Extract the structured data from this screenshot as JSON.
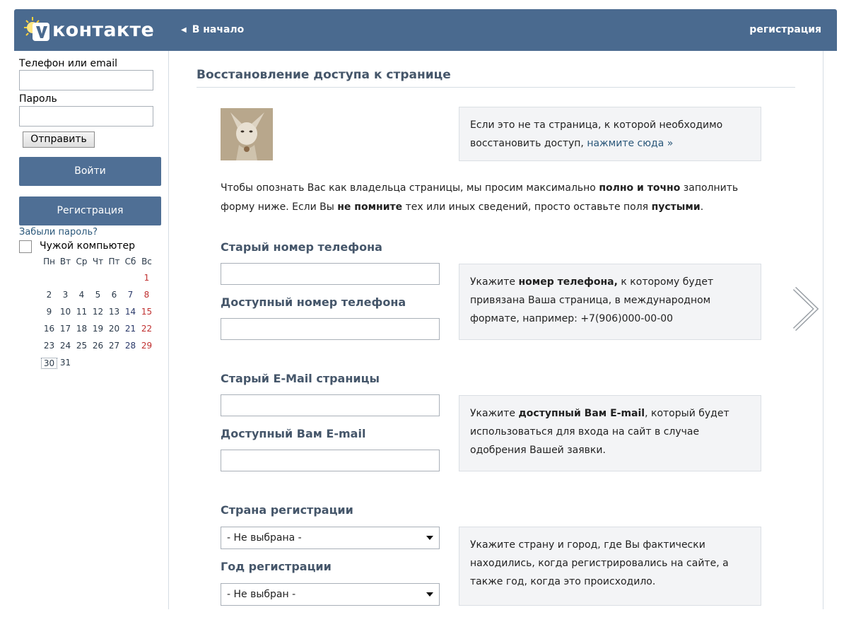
{
  "header": {
    "logo_text": "контакте",
    "nav_home": "В начало",
    "nav_register": "регистрация"
  },
  "sidebar": {
    "phone_label": "Телефон или email",
    "password_label": "Пароль",
    "send_button": "Отправить",
    "login_button": "Войти",
    "register_button": "Регистрация",
    "forgot_password": "Забыли пароль?",
    "foreign_computer": "Чужой компьютер",
    "calendar": {
      "weekdays": [
        "Пн",
        "Вт",
        "Ср",
        "Чт",
        "Пт",
        "Сб",
        "Вс"
      ],
      "rows": [
        [
          "",
          "",
          "",
          "",
          "",
          "",
          "1"
        ],
        [
          "2",
          "3",
          "4",
          "5",
          "6",
          "7",
          "8"
        ],
        [
          "9",
          "10",
          "11",
          "12",
          "13",
          "14",
          "15"
        ],
        [
          "16",
          "17",
          "18",
          "19",
          "20",
          "21",
          "22"
        ],
        [
          "23",
          "24",
          "25",
          "26",
          "27",
          "28",
          "29"
        ],
        [
          "30",
          "31",
          "",
          "",
          "",
          "",
          ""
        ]
      ],
      "today": "30"
    }
  },
  "main": {
    "page_title": "Восстановление доступа к странице",
    "profile_hint": "Если это не та страница, к которой необходимо восстановить доступ,",
    "profile_hint_link": "нажмите сюда »",
    "lead_1": "Чтобы опознать Вас как владельца страницы, мы просим максимально",
    "lead_bold_1": "полно и точно",
    "lead_2": "заполнить форму ниже. Если Вы",
    "lead_bold_2": "не помните",
    "lead_3": "тех или иных сведений, просто оставьте поля",
    "lead_bold_3": "пустыми",
    "lead_end": ".",
    "old_phone_label": "Старый номер телефона",
    "avail_phone_label": "Доступный номер телефона",
    "phone_hint_1": "Укажите",
    "phone_hint_bold": "номер телефона,",
    "phone_hint_2": "к которому будет привязана Ваша страница, в международном формате, например: +7(906)000-00-00",
    "old_email_label": "Старый E-Mail страницы",
    "avail_email_label": "Доступный Вам E-mail",
    "email_hint_1": "Укажите",
    "email_hint_bold": "доступный Вам E-mail",
    "email_hint_2": ", который будет использоваться для входа на сайт в случае одобрения Вашей заявки.",
    "country_label": "Страна регистрации",
    "country_value": "- Не выбрана -",
    "year_label": "Год регистрации",
    "year_value": "- Не выбран -",
    "country_hint": "Укажите страну и город, где Вы фактически находились, когда регистрировались на сайте, а также год, когда это происходило."
  }
}
